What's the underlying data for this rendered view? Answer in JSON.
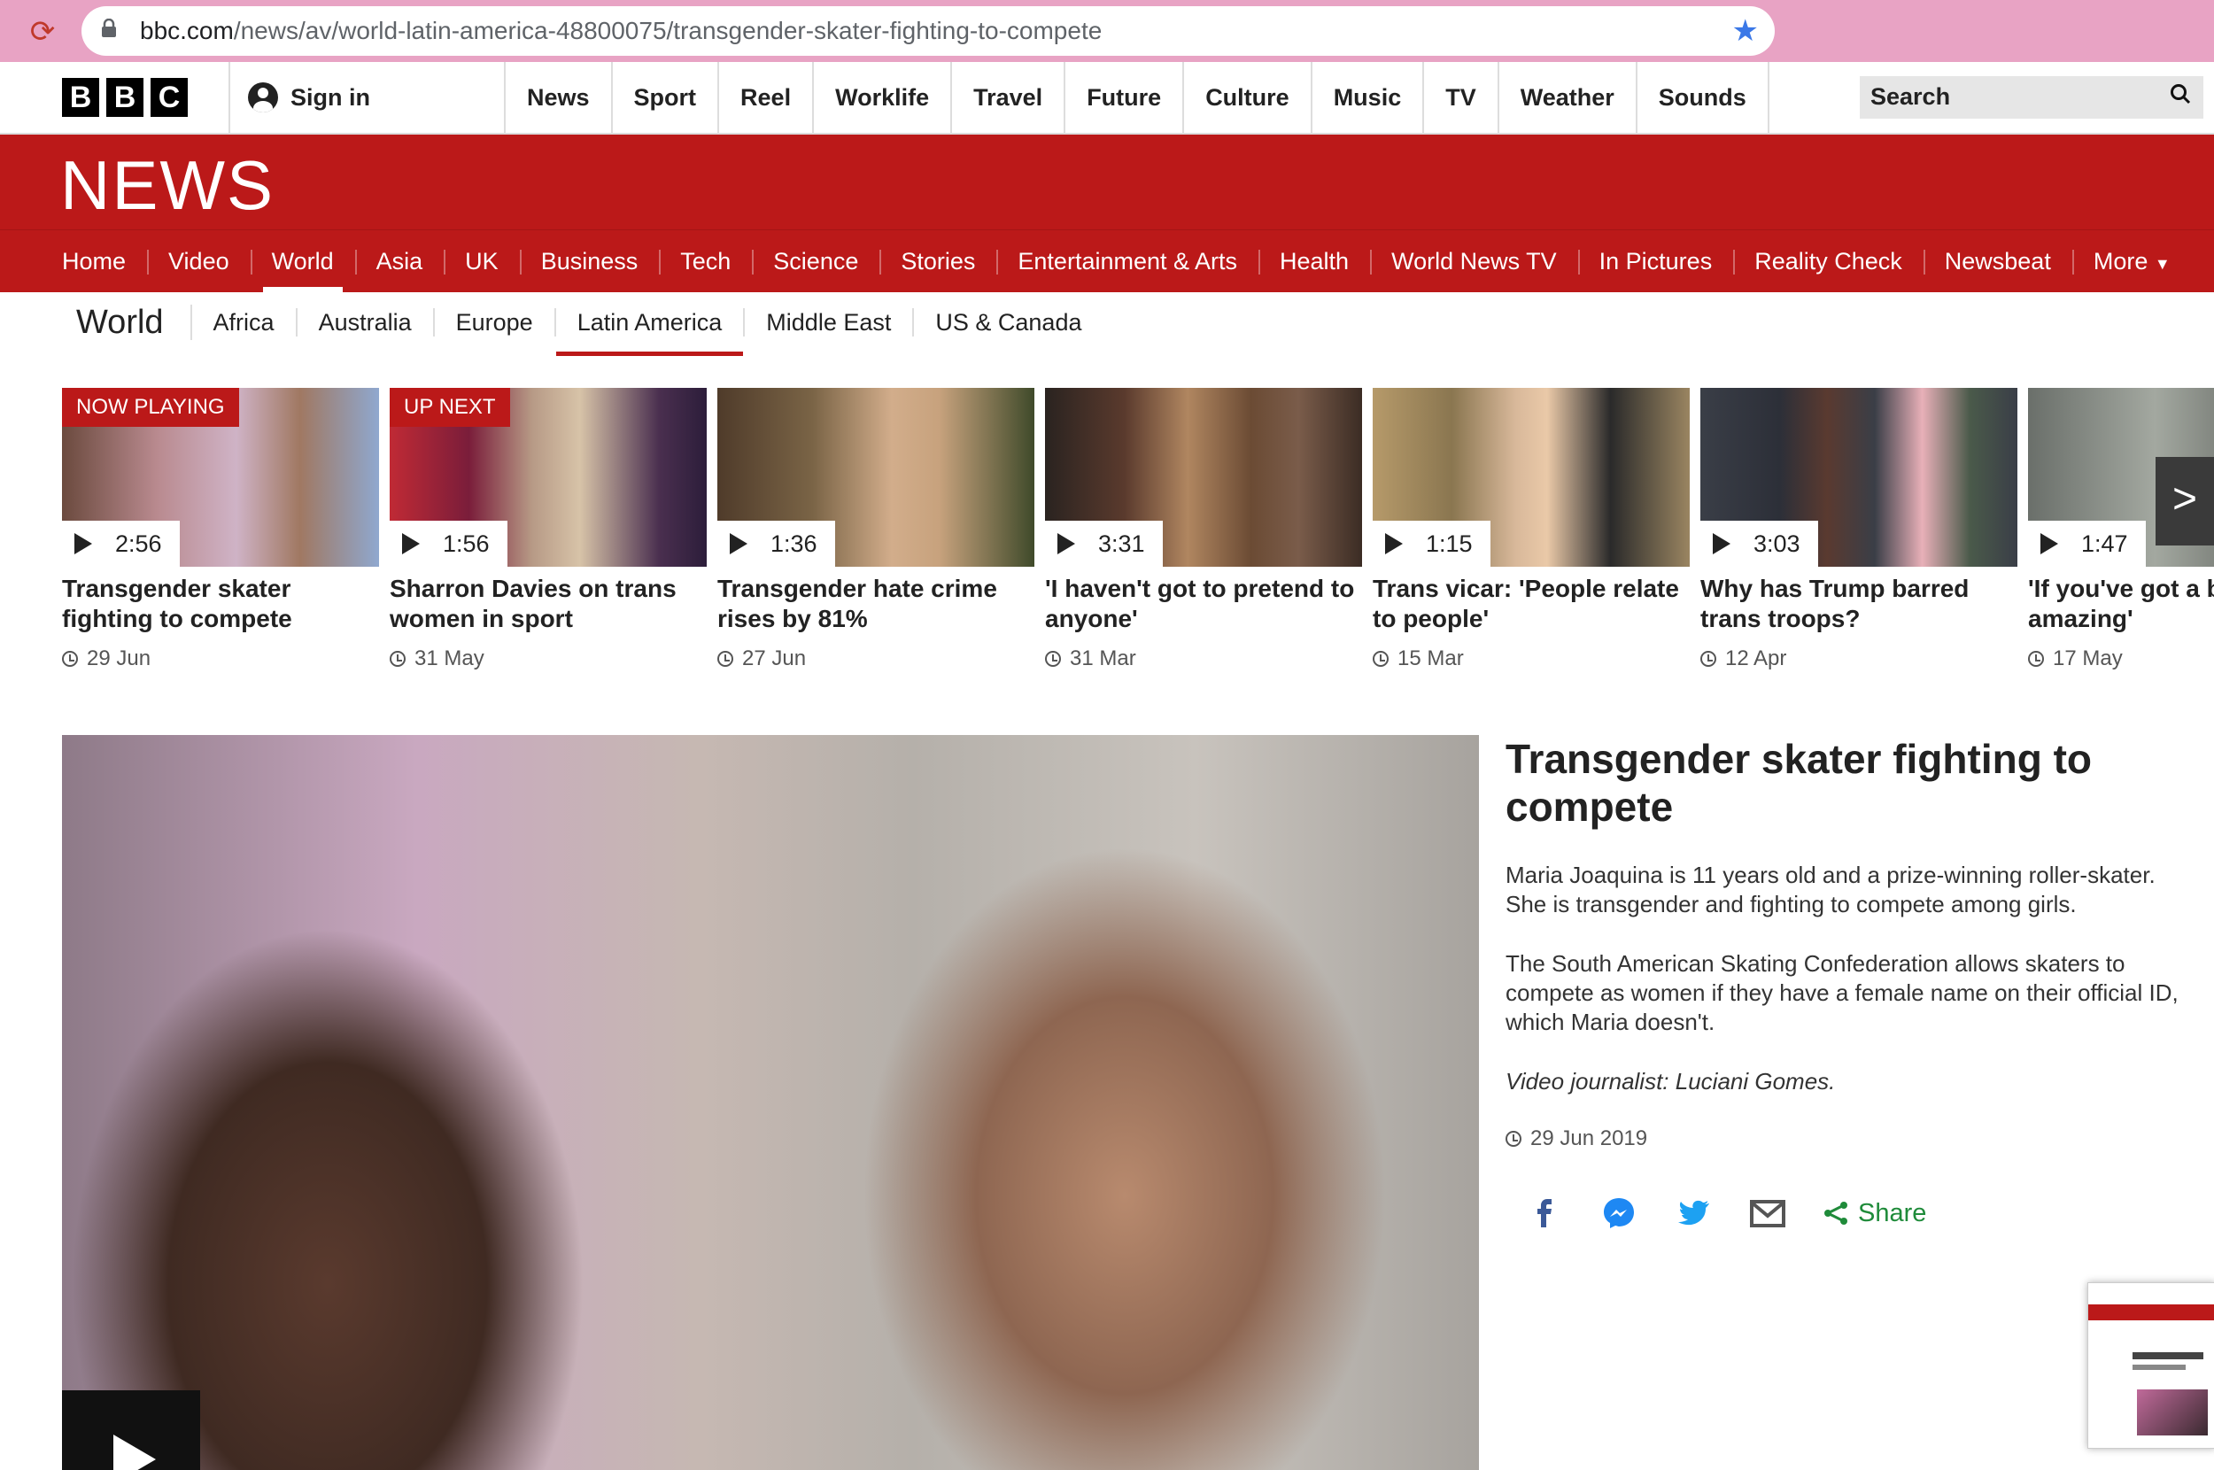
{
  "browser": {
    "url_host": "bbc.com",
    "url_path": "/news/av/world-latin-america-48800075/transgender-skater-fighting-to-compete"
  },
  "header": {
    "logo_letters": [
      "B",
      "B",
      "C"
    ],
    "signin_label": "Sign in",
    "nav": [
      "News",
      "Sport",
      "Reel",
      "Worklife",
      "Travel",
      "Future",
      "Culture",
      "Music",
      "TV",
      "Weather",
      "Sounds"
    ],
    "search_placeholder": "Search"
  },
  "news": {
    "title": "NEWS",
    "sections": [
      "Home",
      "Video",
      "World",
      "Asia",
      "UK",
      "Business",
      "Tech",
      "Science",
      "Stories",
      "Entertainment & Arts",
      "Health",
      "World News TV",
      "In Pictures",
      "Reality Check",
      "Newsbeat",
      "More"
    ],
    "active_section": "World"
  },
  "subnav": {
    "heading": "World",
    "items": [
      "Africa",
      "Australia",
      "Europe",
      "Latin America",
      "Middle East",
      "US & Canada"
    ],
    "active": "Latin America"
  },
  "carousel": [
    {
      "badge": "NOW PLAYING",
      "duration": "2:56",
      "title": "Transgender skater fighting to compete",
      "date": "29 Jun"
    },
    {
      "badge": "UP NEXT",
      "duration": "1:56",
      "title": "Sharron Davies on trans women in sport",
      "date": "31 May"
    },
    {
      "badge": "",
      "duration": "1:36",
      "title": "Transgender hate crime rises by 81%",
      "date": "27 Jun"
    },
    {
      "badge": "",
      "duration": "3:31",
      "title": "'I haven't got to pretend to anyone'",
      "date": "31 Mar"
    },
    {
      "badge": "",
      "duration": "1:15",
      "title": "Trans vicar: 'People relate to people'",
      "date": "15 Mar"
    },
    {
      "badge": "",
      "duration": "3:03",
      "title": "Why has Trump barred trans troops?",
      "date": "12 Apr"
    },
    {
      "badge": "",
      "duration": "1:47",
      "title": "'If you've got a b",
      "title_tail": "amazing'",
      "date": "17 May"
    }
  ],
  "story": {
    "title": "Transgender skater fighting to compete",
    "p1": "Maria Joaquina is 11 years old and a prize-winning roller-skater. She is transgender and fighting to compete among girls.",
    "p2": "The South American Skating Confederation allows skaters to compete as women if they have a female name on their official ID, which Maria doesn't.",
    "credit": "Video journalist: Luciani Gomes.",
    "date": "29 Jun 2019",
    "share_label": "Share"
  },
  "colors": {
    "bbc_red": "#bb1919",
    "browser_bar": "#e8a3c4",
    "share_green": "#1f8b3a"
  }
}
